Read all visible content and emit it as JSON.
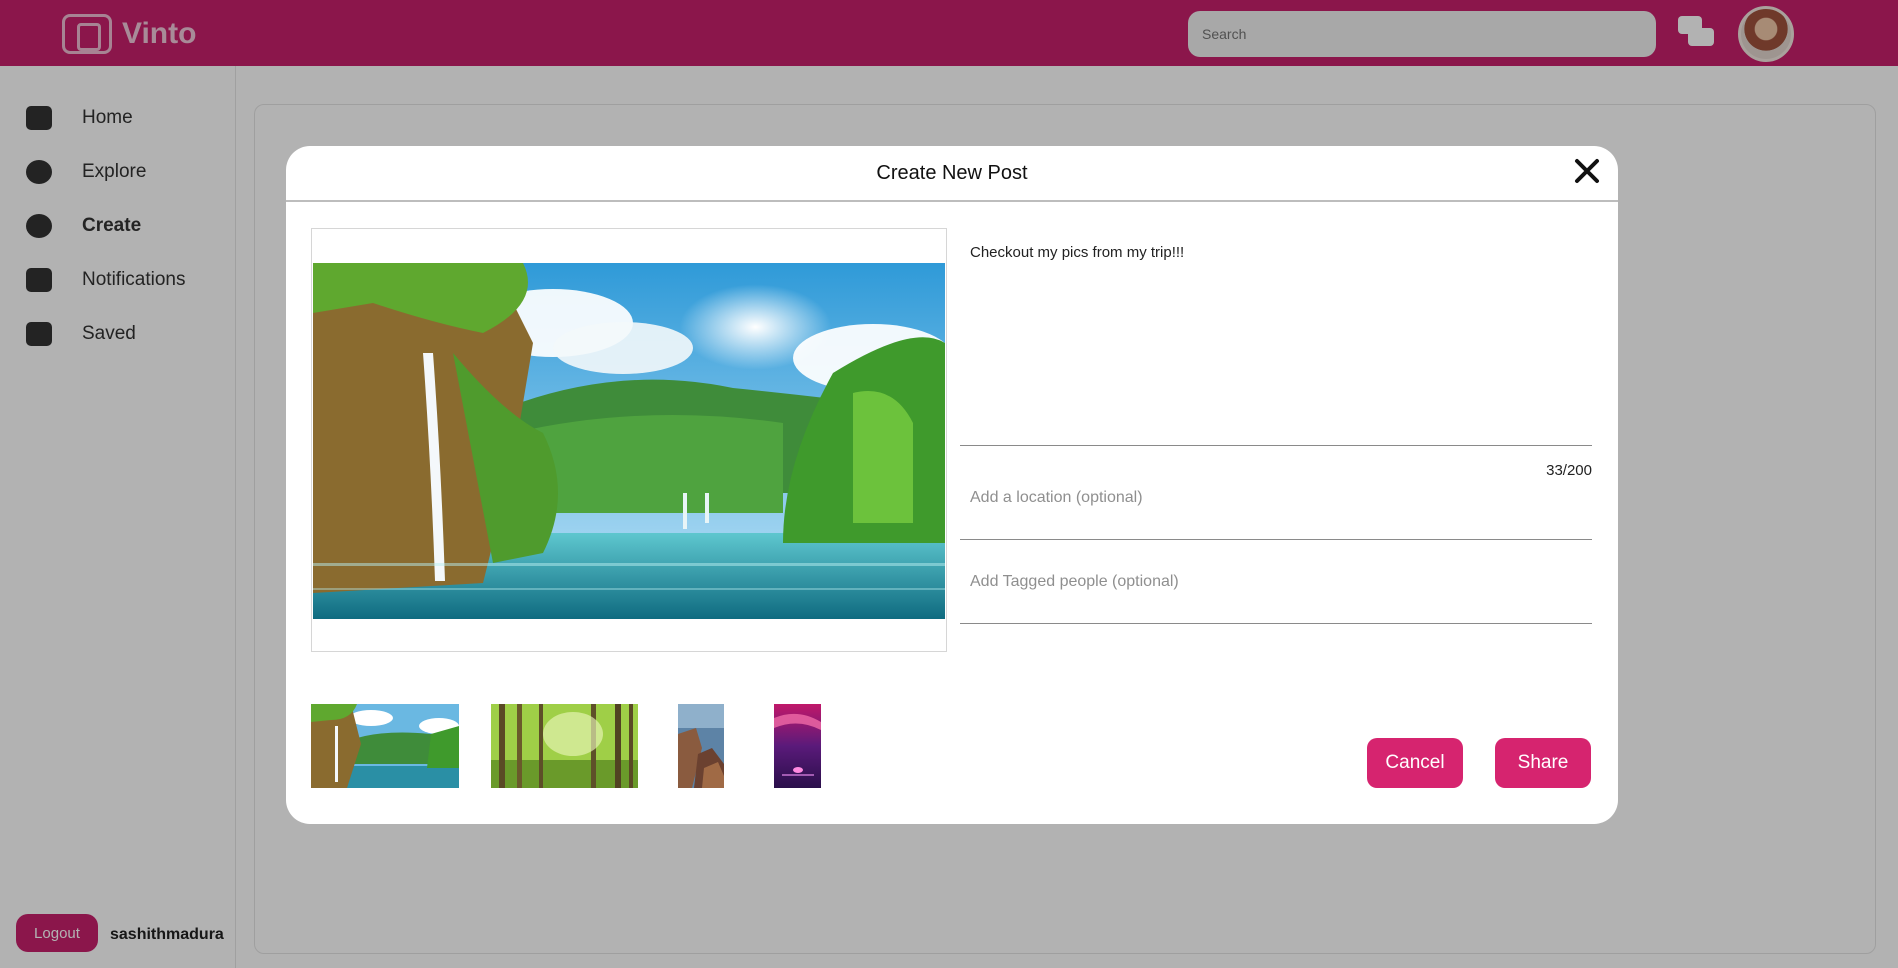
{
  "app": {
    "name": "Vinto",
    "search_placeholder": "Search",
    "brand_color": "#c8206c"
  },
  "sidebar": {
    "items": [
      {
        "label": "Home",
        "icon": "home-icon"
      },
      {
        "label": "Explore",
        "icon": "compass-icon"
      },
      {
        "label": "Create",
        "icon": "create-icon"
      },
      {
        "label": "Notifications",
        "icon": "bell-icon"
      },
      {
        "label": "Saved",
        "icon": "bookmark-icon"
      }
    ],
    "logout_label": "Logout",
    "username": "sashithmadura"
  },
  "modal": {
    "title": "Create New Post",
    "close_icon": "close-icon",
    "caption_value": "Checkout my pics from my trip!!!",
    "char_count": "33/200",
    "location_placeholder": "Add a location (optional)",
    "tagged_placeholder": "Add Tagged people (optional)",
    "cancel_label": "Cancel",
    "share_label": "Share",
    "button_color": "#d6246f",
    "preview_image": "waterfall-lake-landscape",
    "thumbnails": [
      {
        "name": "waterfall-lake-thumbnail",
        "selected": true
      },
      {
        "name": "forest-sunlight-thumbnail",
        "selected": false
      },
      {
        "name": "coastal-rocks-thumbnail",
        "selected": false
      },
      {
        "name": "purple-sunset-thumbnail",
        "selected": false
      }
    ]
  }
}
